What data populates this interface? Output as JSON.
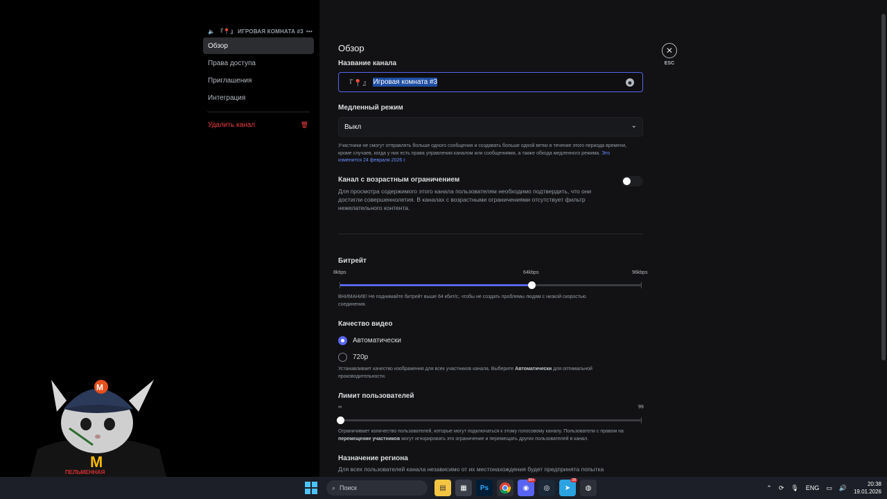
{
  "window": {
    "minimize": "—",
    "maximize": "☐",
    "close": "✕"
  },
  "sidebar": {
    "header": "『📍』 ИГРОВАЯ КОМНАТА #3",
    "items": [
      {
        "label": "Обзор"
      },
      {
        "label": "Права доступа"
      },
      {
        "label": "Приглашения"
      },
      {
        "label": "Интеграция"
      }
    ],
    "delete_label": "Удалить канал"
  },
  "main": {
    "title": "Обзор",
    "channel_name": {
      "label": "Название канала",
      "prefix": "『📍』",
      "value": "Игровая комната #3"
    },
    "slowmode": {
      "label": "Медленный режим",
      "value": "Выкл",
      "help": "Участники не смогут отправлять больше одного сообщения и создавать больше одной ветки в течение этого периода времени, кроме случаев, когда у них есть права управления каналом или сообщениями, а также обхода медленного режима.",
      "link": "Это изменится 24 февраля 2026 г."
    },
    "age": {
      "label": "Канал с возрастным ограничением",
      "desc": "Для просмотра содержимого этого канала пользователям необходимо подтвердить, что они достигли совершеннолетия. В каналах с возрастными ограничениями отсутствует фильтр нежелательного контента.",
      "enabled": false
    },
    "bitrate": {
      "label": "Битрейт",
      "min_label": "8kbps",
      "current_label": "64kbps",
      "max_label": "96kbps",
      "min": 8,
      "value": 64,
      "max": 96,
      "help": "ВНИМАНИЕ! Не поднимайте битрейт выше 64 кбит/с, чтобы не создать проблемы людям с низкой скоростью соединения."
    },
    "video_quality": {
      "label": "Качество видео",
      "options": [
        "Автоматически",
        "720p"
      ],
      "selected": "Автоматически",
      "help_pre": "Устанавливает качество изображения для всех участников канала. Выберите ",
      "help_bold": "Автоматически",
      "help_post": " для оптимальной производительности."
    },
    "user_limit": {
      "label": "Лимит пользователей",
      "min_label": "∞",
      "max_label": "99",
      "value": 0,
      "max": 99,
      "help_pre": "Ограничивает количество пользователей, которые могут подключаться к этому голосовому каналу. Пользователи с правом на ",
      "help_bold": "перемещение участников",
      "help_post": " могут игнорировать это ограничение и перемещать других пользователей в канал."
    },
    "region": {
      "label": "Назначение региона",
      "desc": "Для всех пользователей канала независимо от их местонахождения будет предпринята попытка"
    },
    "close_label": "ESC"
  },
  "taskbar": {
    "search_placeholder": "Поиск",
    "lang": "ENG",
    "time": "20:38",
    "date": "19.01.2026",
    "discord_badge": "99+",
    "telegram_badge": "28"
  },
  "colors": {
    "accent": "#5865f2",
    "danger": "#f23f43",
    "selection": "#1f4ea3"
  },
  "overlay": {
    "cap_logo": "M",
    "shirt_text": "ПЕЛЬМЕННАЯ"
  }
}
